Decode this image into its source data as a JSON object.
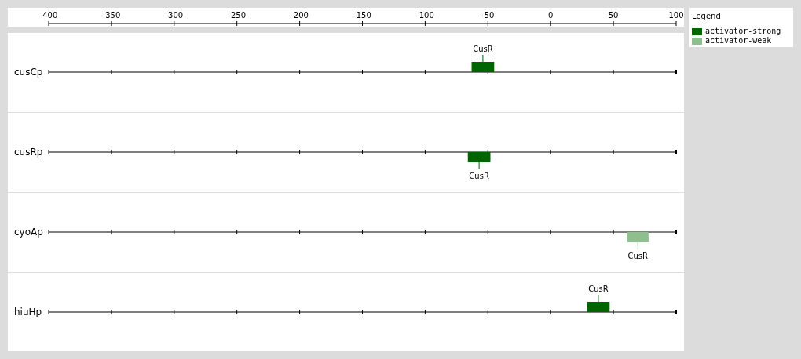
{
  "axis": {
    "ticks": [
      "-400",
      "-350",
      "-300",
      "-250",
      "-200",
      "-150",
      "-100",
      "-50",
      "0",
      "50",
      "100"
    ]
  },
  "tracks": [
    {
      "name": "cusCp",
      "sites": [
        {
          "label": "CusR",
          "above": true,
          "color": "#006400"
        }
      ]
    },
    {
      "name": "cusRp",
      "sites": [
        {
          "label": "CusR",
          "above": false,
          "color": "#006400"
        }
      ]
    },
    {
      "name": "cyoAp",
      "sites": [
        {
          "label": "CusR",
          "above": false,
          "color": "#8fbf8f"
        }
      ]
    },
    {
      "name": "hiuHp",
      "sites": [
        {
          "label": "CusR",
          "above": true,
          "color": "#006400"
        }
      ]
    }
  ],
  "legend": {
    "title": "Legend",
    "items": [
      {
        "label": "activator-strong",
        "color": "#006400"
      },
      {
        "label": "activator-weak",
        "color": "#8fbf8f"
      }
    ]
  }
}
